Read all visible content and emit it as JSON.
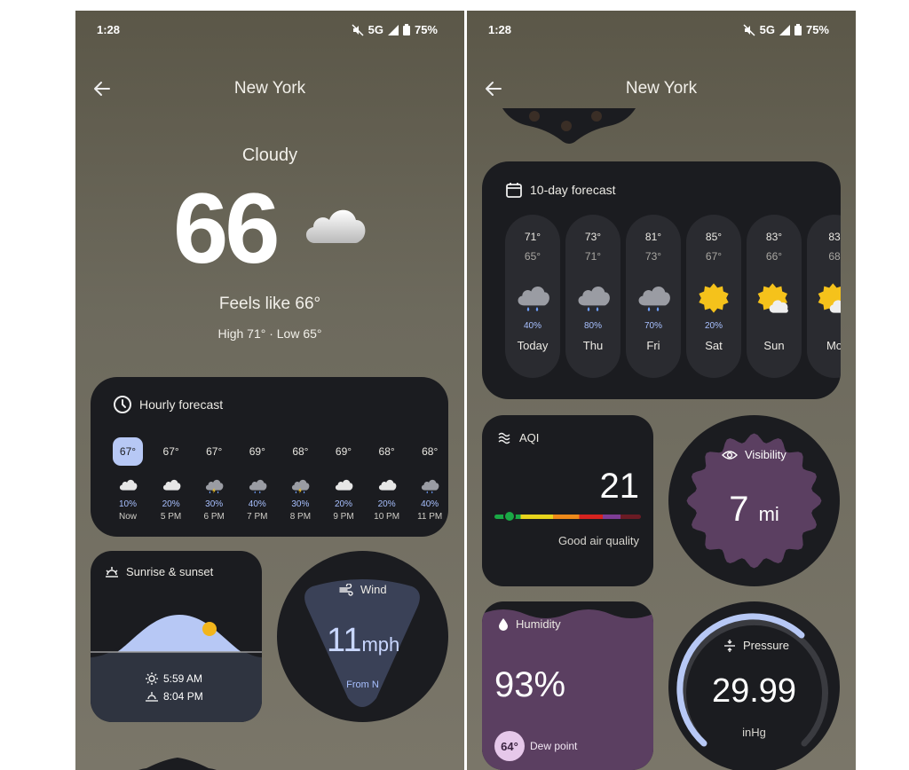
{
  "left": {
    "status": {
      "time": "1:28",
      "network": "5G",
      "battery": "75%"
    },
    "title": "New York",
    "current": {
      "condition": "Cloudy",
      "temp": "66",
      "feels_like": "Feels like 66°",
      "high_low": "High 71° · Low 65°"
    },
    "hourly": {
      "title": "Hourly forecast",
      "hours": [
        {
          "temp": "67°",
          "pct": "10%",
          "label": "Now",
          "icon": "cloud-icon"
        },
        {
          "temp": "67°",
          "pct": "20%",
          "label": "5 PM",
          "icon": "cloud-icon"
        },
        {
          "temp": "67°",
          "pct": "30%",
          "label": "6 PM",
          "icon": "thunder-rain-icon"
        },
        {
          "temp": "69°",
          "pct": "40%",
          "label": "7 PM",
          "icon": "rain-icon"
        },
        {
          "temp": "68°",
          "pct": "30%",
          "label": "8 PM",
          "icon": "thunder-rain-icon"
        },
        {
          "temp": "69°",
          "pct": "20%",
          "label": "9 PM",
          "icon": "cloud-icon"
        },
        {
          "temp": "68°",
          "pct": "20%",
          "label": "10 PM",
          "icon": "cloud-icon"
        },
        {
          "temp": "68°",
          "pct": "40%",
          "label": "11 PM",
          "icon": "rain-icon"
        }
      ]
    },
    "sunrise": {
      "title": "Sunrise & sunset",
      "sunrise": "5:59 AM",
      "sunset": "8:04 PM"
    },
    "wind": {
      "title": "Wind",
      "speed": "11",
      "unit": "mph",
      "from": "From N"
    }
  },
  "right": {
    "status": {
      "time": "1:28",
      "network": "5G",
      "battery": "75%"
    },
    "title": "New York",
    "tenday": {
      "title": "10-day forecast",
      "days": [
        {
          "hi": "71°",
          "lo": "65°",
          "pct": "40%",
          "label": "Today",
          "icon": "rain-icon"
        },
        {
          "hi": "73°",
          "lo": "71°",
          "pct": "80%",
          "label": "Thu",
          "icon": "rain-icon"
        },
        {
          "hi": "81°",
          "lo": "73°",
          "pct": "70%",
          "label": "Fri",
          "icon": "rain-icon"
        },
        {
          "hi": "85°",
          "lo": "67°",
          "pct": "20%",
          "label": "Sat",
          "icon": "sun-icon"
        },
        {
          "hi": "83°",
          "lo": "66°",
          "pct": "",
          "label": "Sun",
          "icon": "partly-sunny-icon"
        },
        {
          "hi": "83",
          "lo": "68",
          "pct": "",
          "label": "Mo",
          "icon": "partly-sunny-icon"
        }
      ]
    },
    "aqi": {
      "title": "AQI",
      "value": "21",
      "level": 0.1,
      "description": "Good air quality"
    },
    "visibility": {
      "title": "Visibility",
      "value": "7",
      "unit": "mi"
    },
    "humidity": {
      "title": "Humidity",
      "value": "93%",
      "dew_point": "64°",
      "dew_label": "Dew point"
    },
    "pressure": {
      "title": "Pressure",
      "value": "29.99",
      "unit": "inHg"
    }
  }
}
